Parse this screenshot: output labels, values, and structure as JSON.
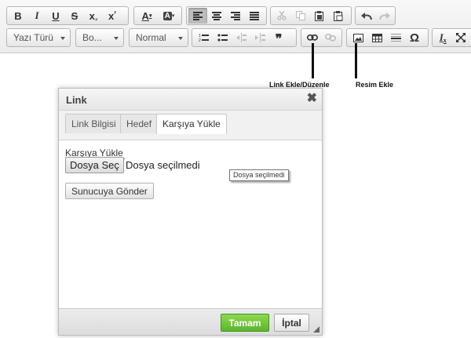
{
  "toolbar": {
    "row1": {
      "bold": "B",
      "italic": "I",
      "underline": "U",
      "strike": "S",
      "subscript": "x",
      "subscript_mark": "₂",
      "superscript": "x",
      "superscript_mark": "²",
      "text_color": "A",
      "bg_color": "A"
    },
    "font_combo": "Yazı Türü",
    "size_combo": "Bo...",
    "format_combo": "Normal",
    "blockquote": "❞",
    "remove_format": "I",
    "remove_format_mark": "x",
    "special_char": "Ω"
  },
  "annotations": {
    "link": "Link Ekle/Düzenle",
    "image": "Resim Ekle"
  },
  "dialog": {
    "title": "Link",
    "close": "✖",
    "tabs": [
      {
        "label": "Link Bilgisi",
        "active": false
      },
      {
        "label": "Hedef",
        "active": false
      },
      {
        "label": "Karşıya Yükle",
        "active": true
      }
    ],
    "upload_label": "Karşıya Yükle",
    "file_button": "Dosya Seç",
    "file_status": "Dosya seçilmedi",
    "tooltip": "Dosya seçilmedi",
    "send_button": "Sunucuya Gönder",
    "ok_button": "Tamam",
    "cancel_button": "İptal"
  },
  "colors": {
    "ok_green": "#6cc23a",
    "toolbar_bg": "#f0f0f0",
    "annotation": "#111111"
  }
}
